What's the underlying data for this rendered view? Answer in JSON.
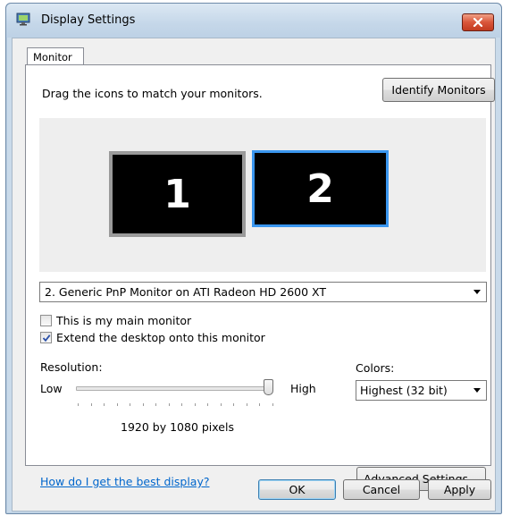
{
  "window": {
    "title": "Display Settings",
    "close_icon": "close-icon",
    "app_icon": "display-settings-icon"
  },
  "tabs": [
    {
      "label": "Monitor",
      "selected": true
    }
  ],
  "monitor_panel": {
    "instruction": "Drag the icons to match your monitors.",
    "identify_button": "Identify Monitors",
    "monitors": [
      {
        "number": "1",
        "selected": false
      },
      {
        "number": "2",
        "selected": true
      }
    ],
    "selected_monitor": "2. Generic PnP Monitor on ATI Radeon HD 2600 XT",
    "main_monitor_label": "This is my main monitor",
    "main_monitor_checked": false,
    "extend_label": "Extend the desktop onto this monitor",
    "extend_checked": true,
    "resolution": {
      "label": "Resolution:",
      "low": "Low",
      "high": "High",
      "slider_fraction": 1.0,
      "value_text": "1920 by 1080 pixels"
    },
    "colors": {
      "label": "Colors:",
      "value": "Highest (32 bit)"
    },
    "help_link": "How do I get the best display?",
    "advanced_button": "Advanced Settings..."
  },
  "footer": {
    "ok": "OK",
    "cancel": "Cancel",
    "apply": "Apply"
  },
  "colors_theme": {
    "accent": "#3a96ef",
    "link": "#0066cc",
    "close_red": "#c23b1f"
  }
}
